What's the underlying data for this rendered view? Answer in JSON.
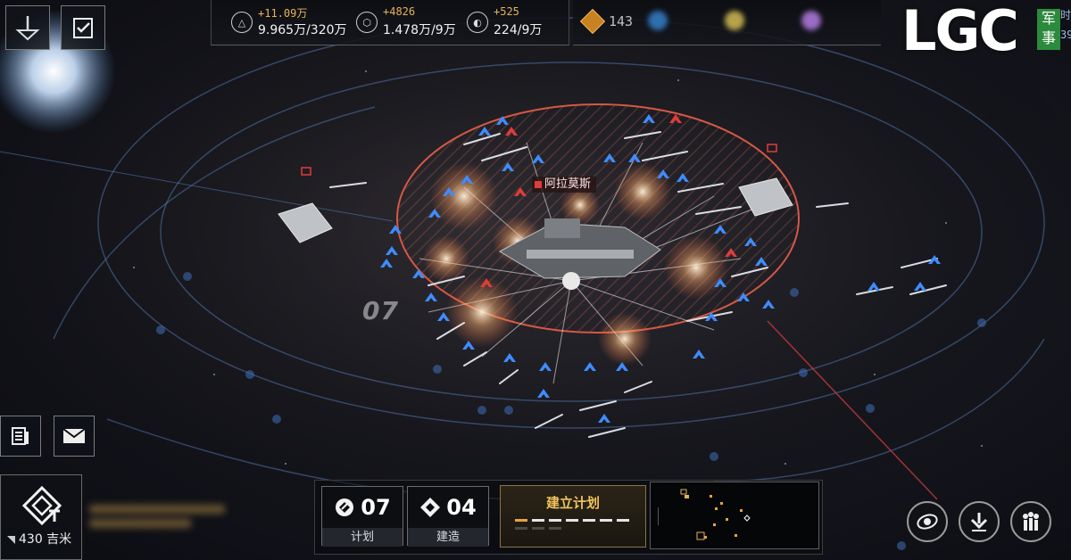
{
  "resources": [
    {
      "icon": "triangle-resource-icon",
      "gain": "+11.09万",
      "amount": "9.965万/320万"
    },
    {
      "icon": "crystal-resource-icon",
      "gain": "+4826",
      "amount": "1.478万/9万"
    },
    {
      "icon": "gas-resource-icon",
      "gain": "+525",
      "amount": "224/9万"
    }
  ],
  "status": {
    "rank_value": "143"
  },
  "logo": {
    "text": "LGC",
    "side_text_1": "军",
    "side_text_2": "事",
    "edge_text_1": "时",
    "edge_text_2": "39"
  },
  "map": {
    "target_name": "阿拉莫斯",
    "sector_label": "07",
    "distance": "430 吉米"
  },
  "counters": [
    {
      "name": "plan",
      "value": "07",
      "label": "计划"
    },
    {
      "name": "build",
      "value": "04",
      "label": "建造"
    }
  ],
  "plan_panel": {
    "title": "建立计划"
  },
  "colors": {
    "accent": "#e7a43a",
    "friendly": "#3f8cff",
    "hostile": "#e23b3b"
  }
}
